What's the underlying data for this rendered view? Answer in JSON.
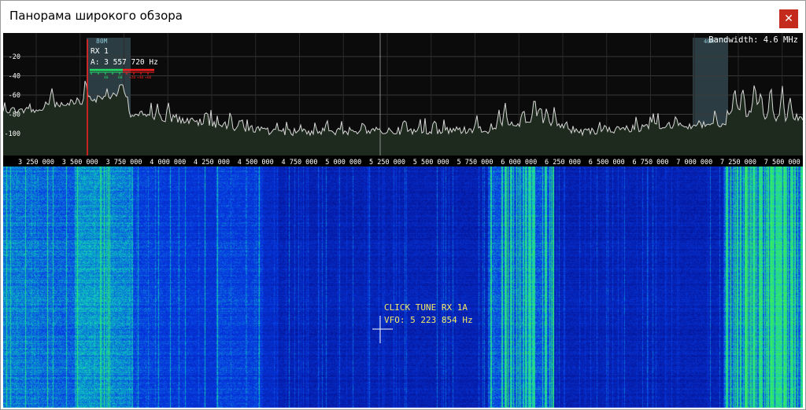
{
  "window": {
    "title": "Панорама широкого обзора",
    "close_glyph": "✕"
  },
  "spectrum": {
    "bandwidth_label": "Bandwidth: 4.6 MHz",
    "dbm_ticks": [
      "-20",
      "-40",
      "-60",
      "-80",
      "-100"
    ],
    "freq_ticks": [
      "3 250 000",
      "3 500 000",
      "3 750 000",
      "4 000 000",
      "4 250 000",
      "4 500 000",
      "4 750 000",
      "5 000 000",
      "5 250 000",
      "5 500 000",
      "5 750 000",
      "6 000 000",
      "6 250 000",
      "6 500 000",
      "6 750 000",
      "7 000 000",
      "7 250 000",
      "7 500 000"
    ],
    "band_80m_label": "80M",
    "band_40m_label": "40M",
    "rx_name": "RX 1",
    "rx_freq": "A: 3 557 720 Hz",
    "smeter_green_labels": [
      "1",
      "3",
      "5",
      "7",
      "9"
    ],
    "smeter_green_sub": [
      "40",
      "60"
    ],
    "smeter_red_labels": [
      "+20",
      "+40",
      "+60"
    ]
  },
  "waterfall": {
    "click_tune_label": "CLICK TUNE RX 1A",
    "vfo_label": "VFO: 5 223 854 Hz"
  },
  "colors": {
    "spectrum_bg": "#0b0b0b",
    "trace": "#d8d8d8",
    "fill": "#1d2a1d",
    "band_highlight": "#6fa8b8",
    "rx_line": "#ff2020",
    "waterfall_base": "#0a1fd0",
    "waterfall_hot": "#22dd66",
    "label_yellow": "#f2e86a",
    "close_red": "#c42b1c"
  }
}
